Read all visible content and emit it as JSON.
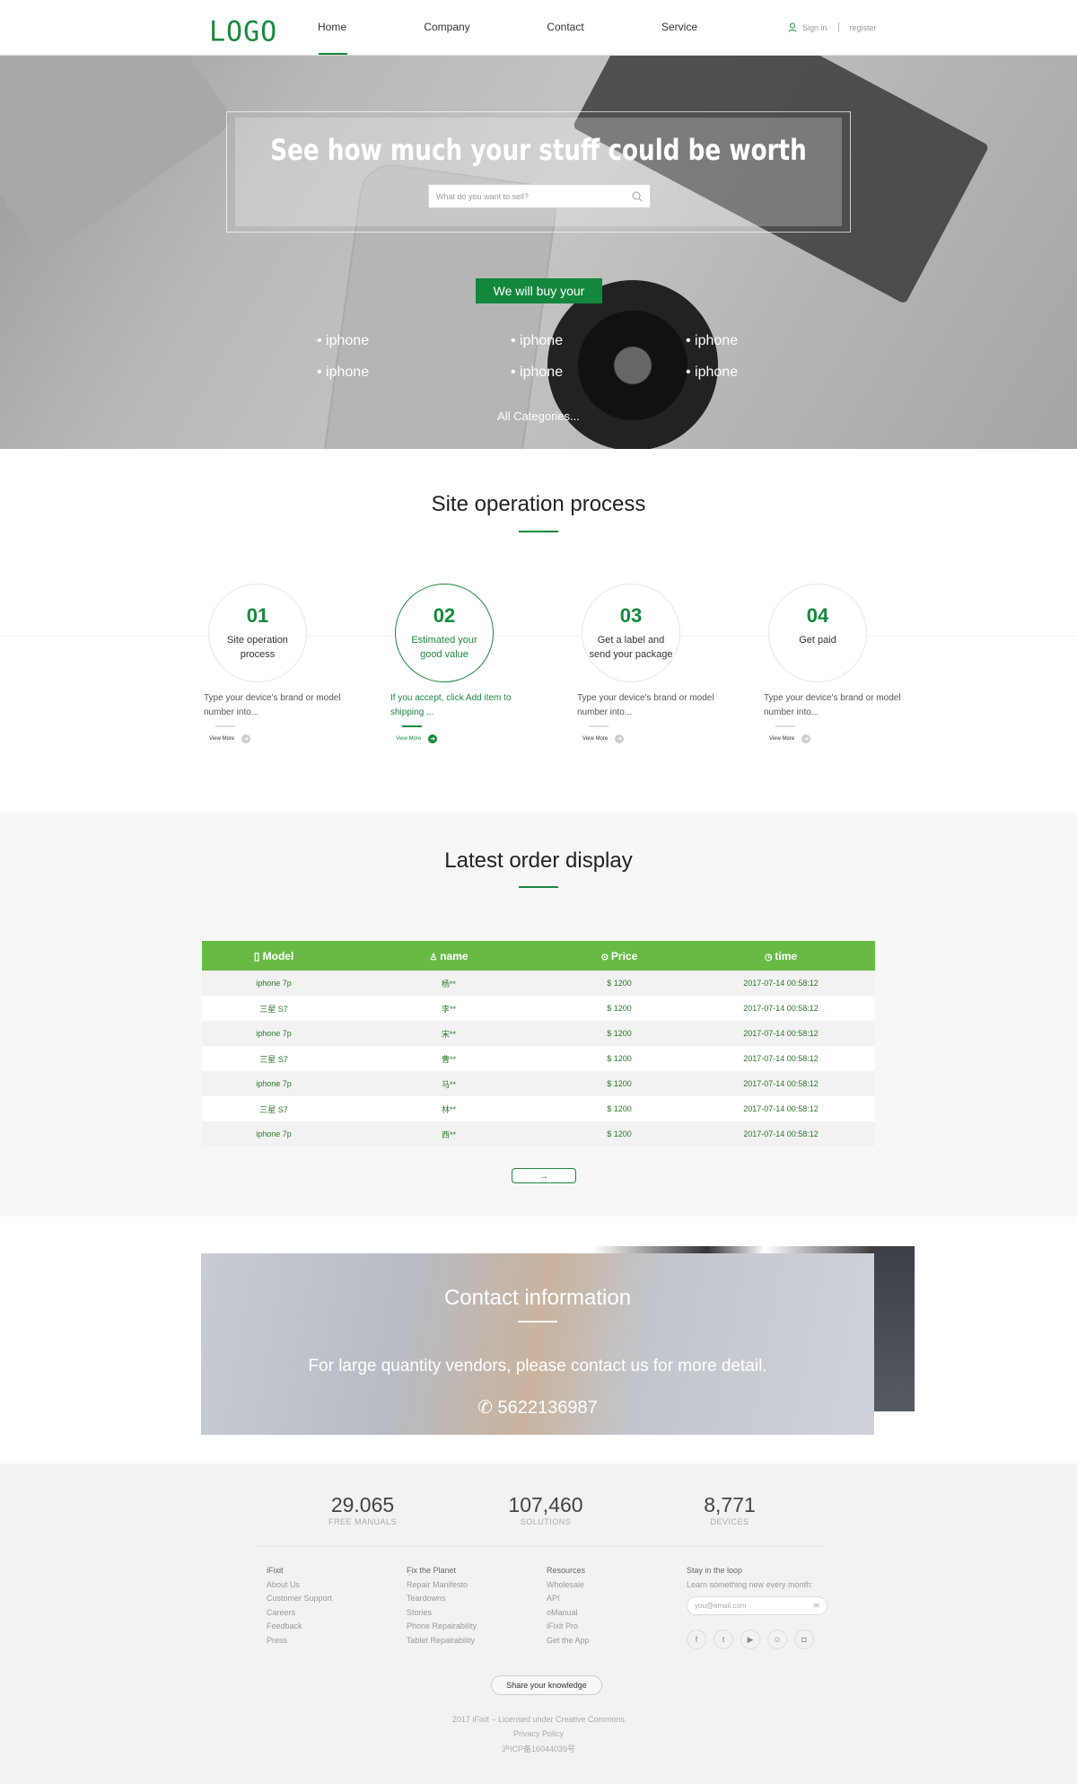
{
  "header": {
    "logo": "LOGO",
    "nav": [
      "Home",
      "Company",
      "Contact",
      "Service"
    ],
    "active_nav": "Home",
    "sign_in": "Sign in",
    "register": "register",
    "accent": "#1a8a3c"
  },
  "hero": {
    "title": "See how much your stuff could be worth",
    "search_placeholder": "What do you want to sell?",
    "buy_button": "We will buy your",
    "items": [
      "• iphone",
      "• iphone",
      "• iphone",
      "• iphone",
      "• iphone",
      "• iphone"
    ],
    "all_categories": "All Categories..."
  },
  "process": {
    "title": "Site operation process",
    "steps": [
      {
        "num": "01",
        "label": "Site operation process",
        "desc": "Type your device's brand or model number into...",
        "more": "View More"
      },
      {
        "num": "02",
        "label": "Estimated your good value",
        "desc": "If you accept, click Add item to shipping ...",
        "more": "View More",
        "active": true
      },
      {
        "num": "03",
        "label": "Get a label and send your package",
        "desc": "Type your device's brand or model number into...",
        "more": "View More"
      },
      {
        "num": "04",
        "label": "Get paid",
        "desc": "Type your device's brand or model number into...",
        "more": "View More"
      }
    ]
  },
  "orders": {
    "title": "Latest order display",
    "header_color": "#67bb45",
    "columns": [
      "Model",
      "name",
      "Price",
      "time"
    ],
    "rows": [
      [
        "iphone 7p",
        "杨**",
        "$ 1200",
        "2017-07-14 00:58:12"
      ],
      [
        "三星 S7",
        "李**",
        "$ 1200",
        "2017-07-14 00:58:12"
      ],
      [
        "iphone 7p",
        "宋**",
        "$ 1200",
        "2017-07-14 00:58:12"
      ],
      [
        "三星 S7",
        "曹**",
        "$ 1200",
        "2017-07-14 00:58:12"
      ],
      [
        "iphone 7p",
        "马**",
        "$ 1200",
        "2017-07-14 00:58:12"
      ],
      [
        "三星 S7",
        "林**",
        "$ 1200",
        "2017-07-14 00:58:12"
      ],
      [
        "iphone 7p",
        "西**",
        "$ 1200",
        "2017-07-14 00:58:12"
      ]
    ],
    "next_icon": "→"
  },
  "contact": {
    "title": "Contact information",
    "text": "For large quantity vendors, please contact us for more detail.",
    "phone": "5622136987"
  },
  "footer": {
    "stats": [
      {
        "n": "29.065",
        "l": "FREE MANUALS"
      },
      {
        "n": "107,460",
        "l": "SOLUTIONS"
      },
      {
        "n": "8,771",
        "l": "DEVICES"
      }
    ],
    "columns": [
      {
        "h": "iFixit",
        "items": [
          "About Us",
          "Customer Support",
          "Careers",
          "Feedback",
          "Press"
        ]
      },
      {
        "h": "Fix the Planet",
        "items": [
          "Repair Manifesto",
          "Teardowns",
          "Stories",
          "Phone Repairability",
          "Tablet Repairability"
        ]
      },
      {
        "h": "Resources",
        "items": [
          "Wholesale",
          "API",
          "oManual",
          "iFixit Pro",
          "Get the App"
        ]
      }
    ],
    "newsletter": {
      "h": "Stay in the loop",
      "sub": "Learn something new every month:",
      "placeholder": "you@email.com"
    },
    "social": [
      "facebook",
      "twitter",
      "youtube",
      "github",
      "instagram"
    ],
    "share": "Share your knowledge",
    "copyright": [
      "2017 iFixit – Licensed under Creative Commons",
      "Privacy Policy",
      "沪ICP备16044039号"
    ]
  }
}
